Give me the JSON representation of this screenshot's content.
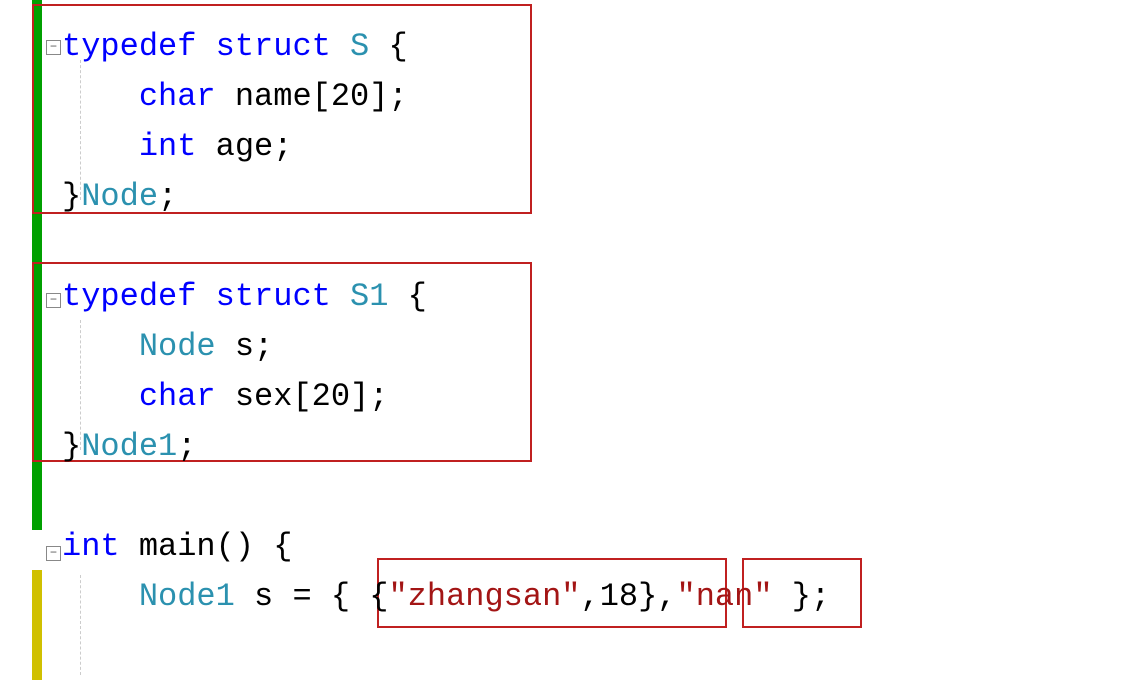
{
  "code": {
    "line1": {
      "typedef": "typedef",
      "struct": "struct",
      "name": "S",
      "brace": " {"
    },
    "line2": {
      "char": "char",
      "ident": " name[20];"
    },
    "line3": {
      "int": "int",
      "ident": " age;"
    },
    "line4": {
      "brace": "}",
      "node": "Node",
      "semi": ";"
    },
    "line6": {
      "typedef": "typedef",
      "struct": "struct",
      "name": "S1",
      "brace": " {"
    },
    "line7": {
      "node": "Node",
      "ident": " s;"
    },
    "line8": {
      "char": "char",
      "ident": " sex[20];"
    },
    "line9": {
      "brace": "}",
      "node": "Node1",
      "semi": ";"
    },
    "line11": {
      "int": "int",
      "main": " main() {"
    },
    "line12": {
      "node": "Node1",
      "s_eq": " s = { {",
      "str1": "\"zhangsan\"",
      "comma1": ",18},",
      "str2": "\"nan\"",
      "end": " };"
    }
  }
}
